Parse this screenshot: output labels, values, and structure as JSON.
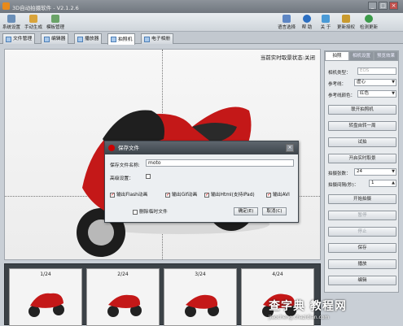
{
  "window": {
    "title": "3D自动拍摄软件 - V2.1.2.6",
    "min": "_",
    "max": "□",
    "close": "×"
  },
  "menubar": {
    "left": [
      {
        "label": "系统设置",
        "icon": "gear-icon"
      },
      {
        "label": "手动生成",
        "icon": "wand-icon"
      },
      {
        "label": "模板管理",
        "icon": "template-icon"
      }
    ],
    "right": [
      {
        "label": "语言选择",
        "icon": "language-icon"
      },
      {
        "label": "帮 助",
        "icon": "help-icon"
      },
      {
        "label": "关 于",
        "icon": "info-icon"
      },
      {
        "label": "更新授权",
        "icon": "key-icon"
      },
      {
        "label": "检测更新",
        "icon": "update-icon"
      }
    ]
  },
  "tabs": [
    {
      "label": "文件管理"
    },
    {
      "label": "编辑器"
    },
    {
      "label": "播放器"
    },
    {
      "label": "拍照机"
    },
    {
      "label": "电子相册"
    }
  ],
  "preview": {
    "status": "当前实时取景状态:关闭"
  },
  "panel": {
    "tabs": [
      "拍照",
      "相机设置",
      "预览效果"
    ],
    "camera_type_label": "相机类型：",
    "camera_type_value": "EOS",
    "ref_line_label": "参考线：",
    "ref_line_value": "虚心",
    "ref_color_label": "参考线颜色：",
    "ref_color_value": "红色",
    "btn_connect": "联开拍照机",
    "btn_turntable": "转盘自转一周",
    "btn_test": "试拍",
    "btn_live": "开启实时取景",
    "shots_label": "拍摄张数：",
    "shots_value": "24",
    "interval_label": "拍摄间隔(秒)：",
    "interval_value": "1",
    "btn_start": "开始拍摄",
    "btn_pause": "暂停",
    "btn_stop": "停止",
    "btn_save": "保存",
    "btn_play": "播放",
    "btn_edit": "编辑"
  },
  "thumbs": [
    {
      "label": "1/24"
    },
    {
      "label": "2/24"
    },
    {
      "label": "3/24"
    },
    {
      "label": "4/24"
    }
  ],
  "dialog": {
    "title": "保存文件",
    "close": "×",
    "name_label": "保存文件名称:",
    "name_value": "moto",
    "advanced_label": "高级设置：",
    "opt_flash": "输出Flash动画",
    "opt_gif": "输出Gif动画",
    "opt_html": "输出Html(支持iPad)",
    "opt_avi": "输出AVI",
    "opt_delete": "删除临时文件",
    "ok": "确定(E)",
    "cancel": "取消(C)"
  },
  "watermark": {
    "big": "查字典 教程网",
    "small": "jiaocheng.chazidian.com"
  }
}
